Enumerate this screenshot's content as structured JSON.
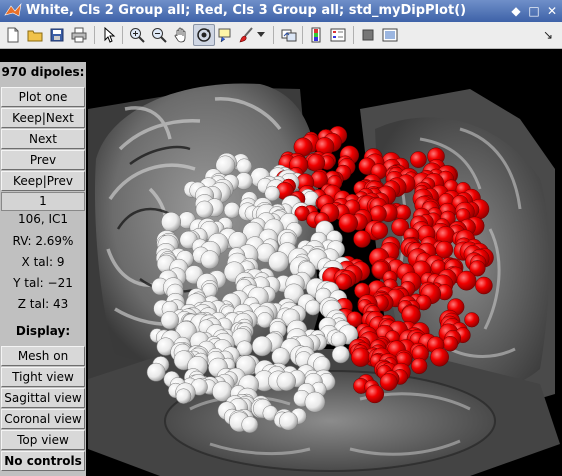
{
  "window": {
    "title": "White, Cls 2 Group all; Red, Cls 3 Group all; std_myDipPlot()"
  },
  "titlebar_buttons": [
    "◆",
    "□",
    "✕"
  ],
  "toolbar": {
    "tools": [
      {
        "name": "new-figure-icon"
      },
      {
        "name": "open-file-icon"
      },
      {
        "name": "save-icon"
      },
      {
        "name": "print-icon"
      },
      {
        "name": "pointer-icon"
      },
      {
        "name": "zoom-in-icon"
      },
      {
        "name": "zoom-out-icon"
      },
      {
        "name": "pan-hand-icon"
      },
      {
        "name": "rotate-3d-icon",
        "active": true
      },
      {
        "name": "data-cursor-icon"
      },
      {
        "name": "brush-icon"
      },
      {
        "name": "dropdown-arrow-icon"
      },
      {
        "name": "link-plot-icon"
      },
      {
        "name": "colorbar-icon"
      },
      {
        "name": "legend-icon"
      },
      {
        "name": "hide-plot-tools-icon"
      },
      {
        "name": "show-plot-tools-icon"
      }
    ],
    "dock_arrow": "↘"
  },
  "panel": {
    "header": "970 dipoles:",
    "buttons_top": [
      "Plot one",
      "Keep|Next",
      "Next",
      "Prev",
      "Keep|Prev"
    ],
    "index_value": "1",
    "component": "106, IC1",
    "rv": "RV: 2.69%",
    "x_tal": "X tal: 9",
    "y_tal": "Y tal: −21",
    "z_tal": "Z tal: 43",
    "display_label": "Display:",
    "buttons_bottom": [
      "Mesh on",
      "Tight view",
      "Sagittal view",
      "Coronal view",
      "Top view",
      "No controls"
    ]
  },
  "colors": {
    "dipole_group_a": "#ffffff",
    "dipole_group_b": "#ff0000"
  }
}
